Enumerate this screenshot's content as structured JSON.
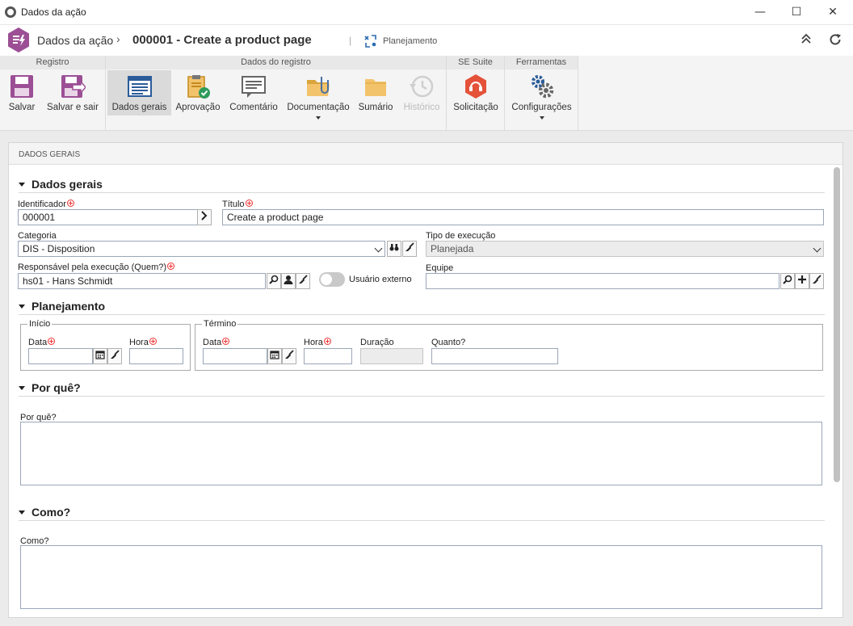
{
  "window": {
    "title": "Dados da ação",
    "minimize": "—",
    "maximize": "☐",
    "close": "✕"
  },
  "header": {
    "breadcrumb_root": "Dados da ação",
    "separator": "›",
    "record_title": "000001 - Create a product page",
    "divider": "|",
    "status_label": "Planejamento"
  },
  "ribbon": {
    "groups": [
      {
        "title": "Registro"
      },
      {
        "title": "Dados do registro"
      },
      {
        "title": "SE Suite"
      },
      {
        "title": "Ferramentas"
      }
    ],
    "buttons": {
      "salvar": "Salvar",
      "salvar_sair": "Salvar e sair",
      "dados_gerais": "Dados gerais",
      "aprovacao": "Aprovação",
      "comentario": "Comentário",
      "documentacao": "Documentação",
      "sumario": "Sumário",
      "historico": "Histórico",
      "solicitacao": "Solicitação",
      "configuracoes": "Configurações"
    }
  },
  "panel": {
    "header": "DADOS GERAIS",
    "sections": {
      "dados_gerais": "Dados gerais",
      "planejamento": "Planejamento",
      "por_que": "Por quê?",
      "como": "Como?"
    },
    "fields": {
      "identificador": {
        "label": "Identificador",
        "value": "000001"
      },
      "titulo": {
        "label": "Título",
        "value": "Create a product page"
      },
      "categoria": {
        "label": "Categoria",
        "value": "DIS - Disposition"
      },
      "tipo_execucao": {
        "label": "Tipo de execução",
        "value": "Planejada"
      },
      "responsavel": {
        "label": "Responsável pela execução (Quem?)",
        "value": "hs01 - Hans Schmidt"
      },
      "usuario_externo": {
        "label": "Usuário externo",
        "checked": false
      },
      "equipe": {
        "label": "Equipe",
        "value": ""
      }
    },
    "planejamento": {
      "inicio": {
        "legend": "Início",
        "data_label": "Data",
        "hora_label": "Hora",
        "data": "",
        "hora": ""
      },
      "termino": {
        "legend": "Término",
        "data_label": "Data",
        "hora_label": "Hora",
        "duracao_label": "Duração",
        "quanto_label": "Quanto?",
        "data": "",
        "hora": "",
        "duracao": "",
        "quanto": ""
      }
    },
    "por_que_label": "Por quê?",
    "como_label": "Como?"
  }
}
